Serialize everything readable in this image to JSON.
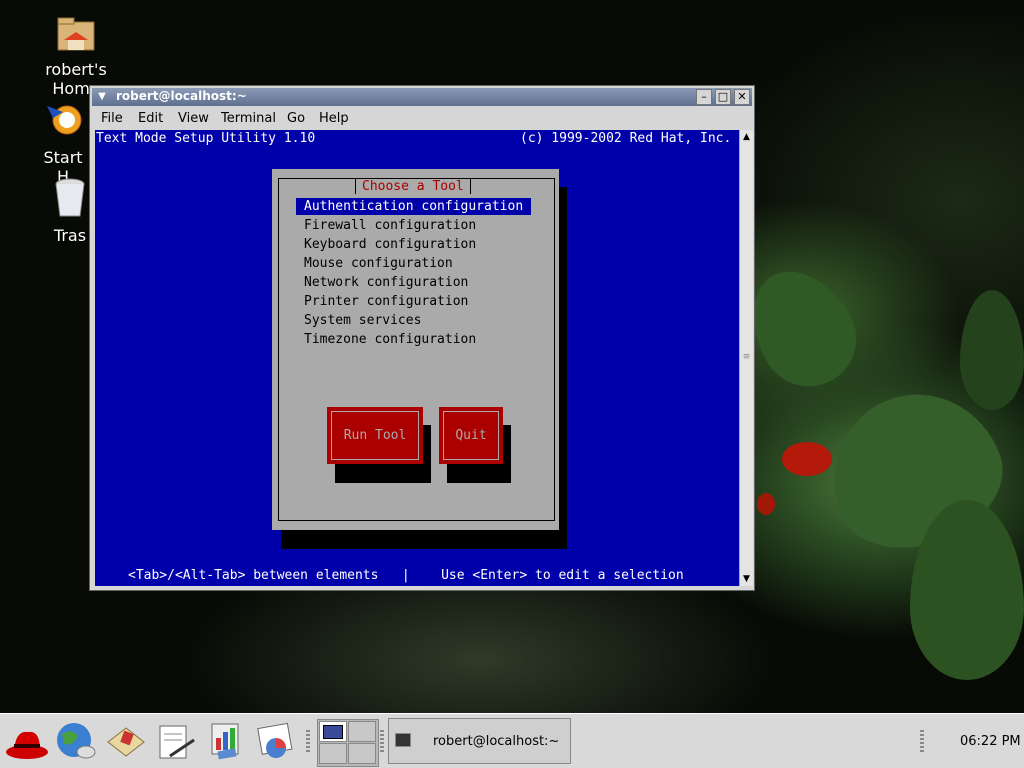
{
  "desktop": {
    "icons": [
      {
        "label": "robert's Home",
        "icon": "home-folder-icon"
      },
      {
        "label": "Start H",
        "icon": "start-here-icon"
      },
      {
        "label": "Tras",
        "icon": "trash-icon"
      }
    ]
  },
  "window": {
    "title": "robert@localhost:~",
    "menu": [
      "File",
      "Edit",
      "View",
      "Terminal",
      "Go",
      "Help"
    ],
    "controls": [
      "minimize-icon",
      "maximize-icon",
      "close-icon"
    ]
  },
  "terminal": {
    "header_left": "Text Mode Setup Utility 1.10",
    "header_right": "(c) 1999-2002 Red Hat, Inc.",
    "dialog_title": "Choose a Tool",
    "tools": [
      "Authentication configuration",
      "Firewall configuration",
      "Keyboard configuration",
      "Mouse configuration",
      "Network configuration",
      "Printer configuration",
      "System services",
      "Timezone configuration"
    ],
    "selected_index": 0,
    "buttons": {
      "run": "Run Tool",
      "quit": "Quit"
    },
    "footer": "<Tab>/<Alt-Tab> between elements   |    Use <Enter> to edit a selection"
  },
  "panel": {
    "launchers": [
      "redhat-menu-icon",
      "web-browser-icon",
      "email-icon",
      "writer-icon",
      "presentation-icon",
      "spreadsheet-icon"
    ],
    "task_label": "robert@localhost:~",
    "clock": "06:22 PM"
  },
  "colors": {
    "terminal_bg": "#0000aa",
    "dialog_bg": "#aaaaaa",
    "button_bg": "#aa0000",
    "dialog_title": "#aa0000"
  }
}
